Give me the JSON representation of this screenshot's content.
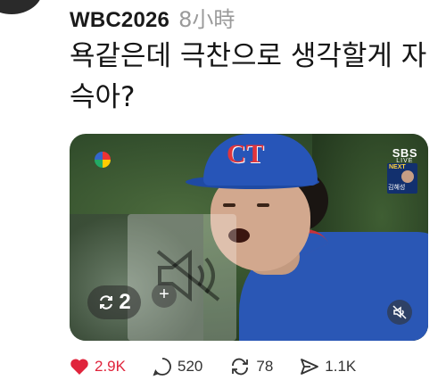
{
  "post": {
    "username": "WBC2026",
    "time": "8小時",
    "text": "욕같은데 극찬으로 생각할게 자슥아?"
  },
  "media": {
    "broadcaster": "SBS",
    "broadcaster_sub": "LIVE",
    "next_label": "NEXT",
    "next_name": "김혜성",
    "repost_count": "2",
    "muted": true
  },
  "actions": {
    "likes": "2.9K",
    "comments": "520",
    "reposts": "78",
    "shares": "1.1K"
  },
  "colors": {
    "like": "#e0243c",
    "text": "#151515",
    "secondary": "#9a9a9a"
  }
}
